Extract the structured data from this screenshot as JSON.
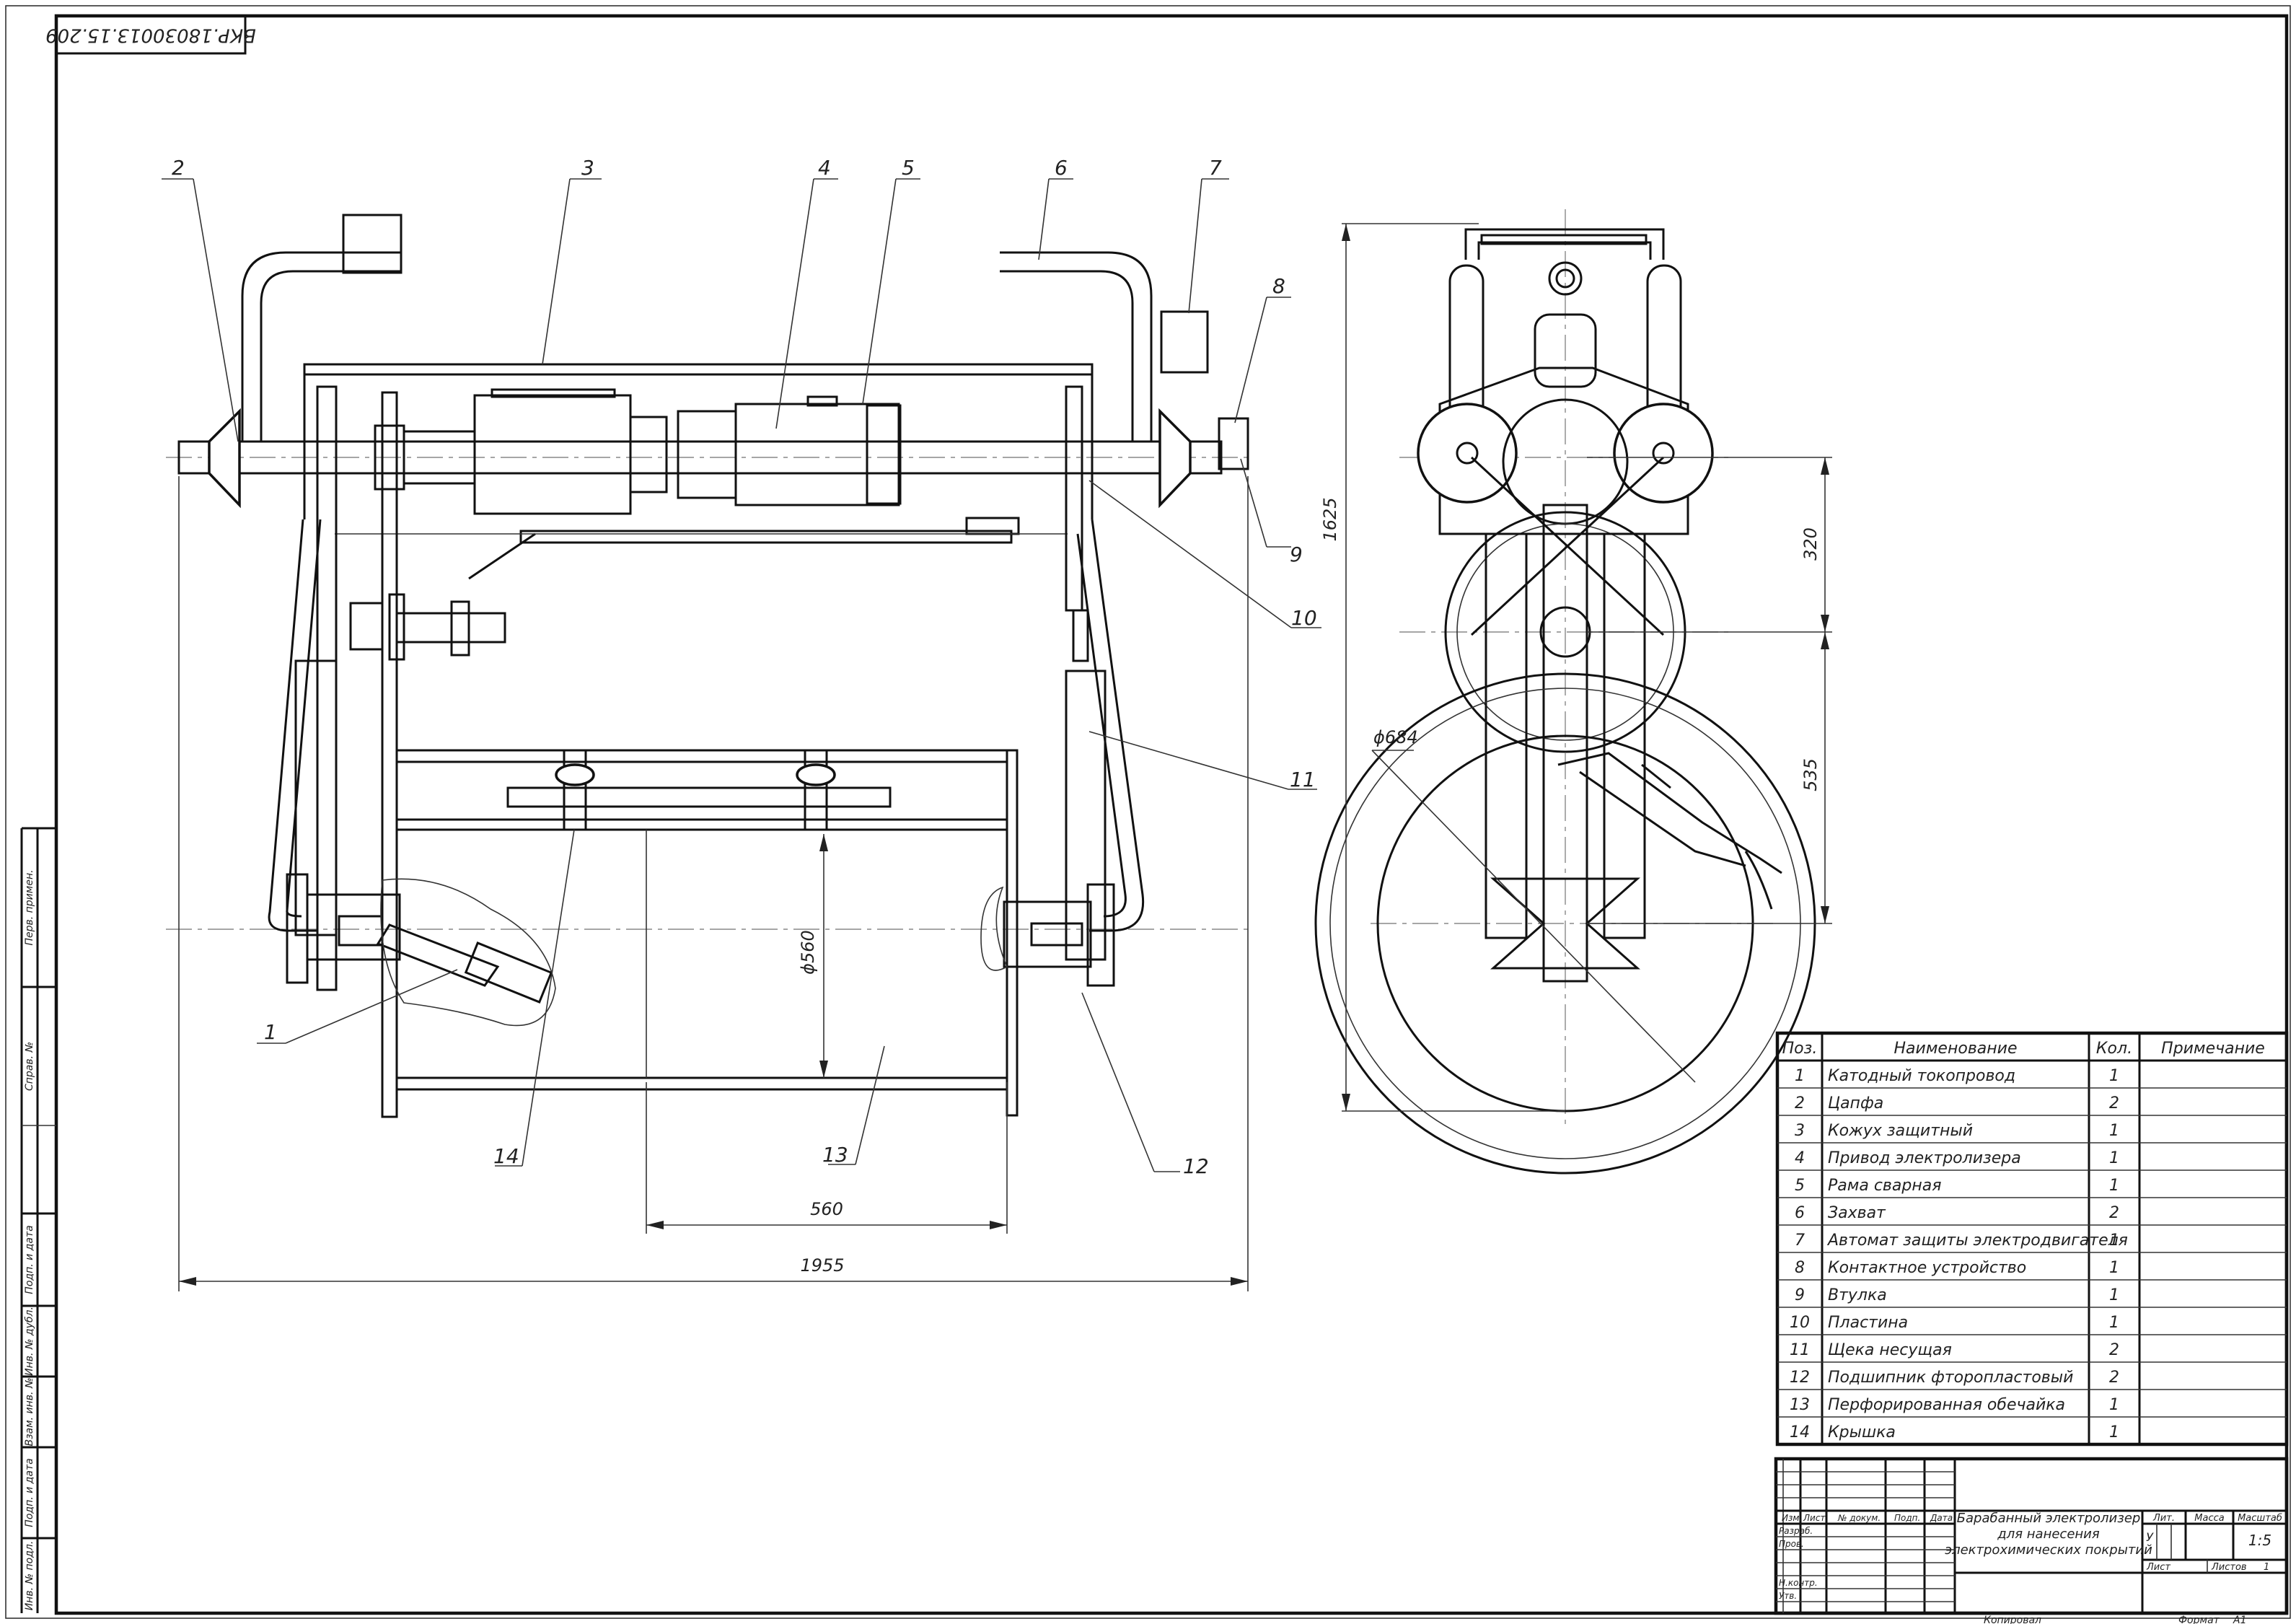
{
  "drawing": {
    "designation": "ВКР.18030013.15.209",
    "callouts": [
      "1",
      "2",
      "3",
      "4",
      "5",
      "6",
      "7",
      "8",
      "9",
      "10",
      "11",
      "12",
      "13",
      "14"
    ],
    "dimensions": {
      "overall_length": "1955",
      "drum_length": "560",
      "drum_diameter": "ϕ560",
      "height": "1625",
      "spacing_upper": "320",
      "spacing_lower": "535",
      "outer_diameter": "ϕ684"
    }
  },
  "spec_table": {
    "headers": [
      "Поз.",
      "Наименование",
      "Кол.",
      "Примечание"
    ],
    "rows": [
      {
        "pos": "1",
        "name": "Катодный токопровод",
        "qty": "1"
      },
      {
        "pos": "2",
        "name": "Цапфа",
        "qty": "2"
      },
      {
        "pos": "3",
        "name": "Кожух защитный",
        "qty": "1"
      },
      {
        "pos": "4",
        "name": "Привод электролизера",
        "qty": "1"
      },
      {
        "pos": "5",
        "name": "Рама сварная",
        "qty": "1"
      },
      {
        "pos": "6",
        "name": "Захват",
        "qty": "2"
      },
      {
        "pos": "7",
        "name": "Автомат защиты электродвигателя",
        "qty": "1"
      },
      {
        "pos": "8",
        "name": "Контактное устройство",
        "qty": "1"
      },
      {
        "pos": "9",
        "name": "Втулка",
        "qty": "1"
      },
      {
        "pos": "10",
        "name": "Пластина",
        "qty": "1"
      },
      {
        "pos": "11",
        "name": "Щека несущая",
        "qty": "2"
      },
      {
        "pos": "12",
        "name": "Подшипник фторопластовый",
        "qty": "2"
      },
      {
        "pos": "13",
        "name": "Перфорированная обечайка",
        "qty": "1"
      },
      {
        "pos": "14",
        "name": "Крышка",
        "qty": "1"
      }
    ]
  },
  "title_block": {
    "title_lines": [
      "Барабанный электролизер",
      "для нанесения",
      "электрохимических покрытий"
    ],
    "col_headers": [
      "Изм.",
      "Лист",
      "№ докум.",
      "Подп.",
      "Дата"
    ],
    "row_labels": [
      "Разраб.",
      "Пров.",
      "",
      "Н.контр.",
      "Утв."
    ],
    "lit_label": "Лит.",
    "mass_label": "Масса",
    "scale_label": "Масштаб",
    "lit_value": "У",
    "scale_value": "1:5",
    "sheet_label": "Лист",
    "sheets_label": "Листов",
    "sheets_value": "1",
    "copied_label": "Копировал",
    "format_label": "Формат",
    "format_value": "А1"
  },
  "side_stamp": [
    "Перв. примен.",
    "Справ. №",
    "Подп. и дата",
    "Инв. № дубл.",
    "Взам. инв. №",
    "Подп. и дата",
    "Инв. № подл."
  ]
}
